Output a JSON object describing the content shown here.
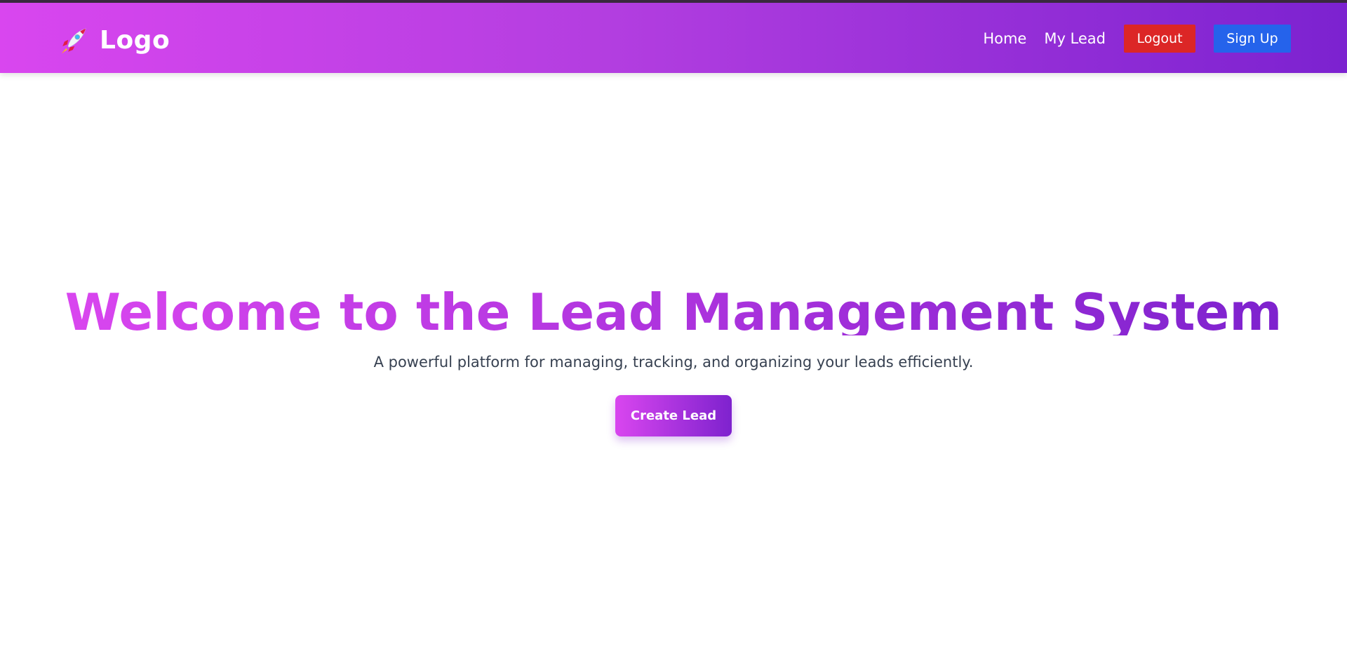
{
  "header": {
    "logo_text": "Logo",
    "logo_icon": "rocket-icon",
    "nav": {
      "home": "Home",
      "my_lead": "My Lead",
      "logout": "Logout",
      "signup": "Sign Up"
    }
  },
  "hero": {
    "title": "Welcome to the Lead Management System",
    "subtitle": "A powerful platform for managing, tracking, and organizing your leads efficiently.",
    "cta": "Create Lead"
  },
  "colors": {
    "gradient_start": "#d946ef",
    "gradient_end": "#7e22ce",
    "logout_button": "#dc2626",
    "signup_button": "#2563eb",
    "subtitle_text": "#374151"
  }
}
